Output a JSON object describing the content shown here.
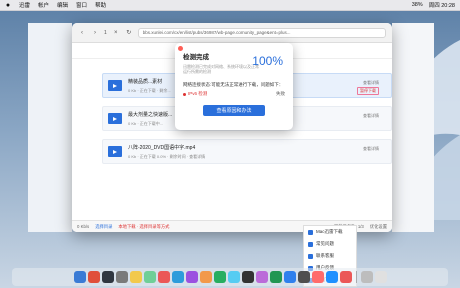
{
  "menubar": {
    "items": [
      "迅雷",
      "帐户",
      "编辑",
      "窗口",
      "帮助"
    ],
    "right": [
      "38%",
      "周四 20:28"
    ]
  },
  "browser": {
    "tab_count": "1",
    "url": "bbs.xunlei.com/cx/en/list/pubs/36987/wb-page.comunity_page&ent=plus..."
  },
  "downloader": {
    "tabs": [
      {
        "label": "播放"
      },
      {
        "label": "正在下载"
      },
      {
        "label": "已完成"
      },
      {
        "label": "云盘"
      }
    ],
    "rows": [
      {
        "name": "精装品质...素材",
        "meta": "0 Kb · 正在下载 · 剩余...",
        "action_top": "查看详情",
        "action_mid": "暂停下载"
      },
      {
        "name": "最大剂量之快速版...",
        "meta": "0 Kb · 正在下载中...",
        "action_top": "查看详情",
        "action_mid": ""
      },
      {
        "name": "八阵-2020_DVD国语中字.mp4",
        "meta": "0 Kb · 正在下载 0.0% · 剩余时间 · 查看详情",
        "action_top": "查看详情",
        "action_mid": ""
      }
    ],
    "status": {
      "left": [
        "0 Kb/s",
        "选择目录"
      ],
      "warn": "本地下载 · 选择目录等方式",
      "right": [
        "下载任务数: 1/3",
        "优化设置"
      ]
    }
  },
  "modal": {
    "title": "检测完成",
    "percent": "100%",
    "subtitle": "迅雷检测已完成对网络、系统环境以及正常运行所需的检测",
    "question": "网络连接状态:可能无法正常进行下载，问题如下：",
    "issue_label": "IPv6 检测",
    "issue_status": "失败",
    "button": "查看原因和办法"
  },
  "side_menu": [
    "Mac迅雷下载",
    "常见问题",
    "联系客服",
    "用户反馈",
    "限速下载"
  ]
}
